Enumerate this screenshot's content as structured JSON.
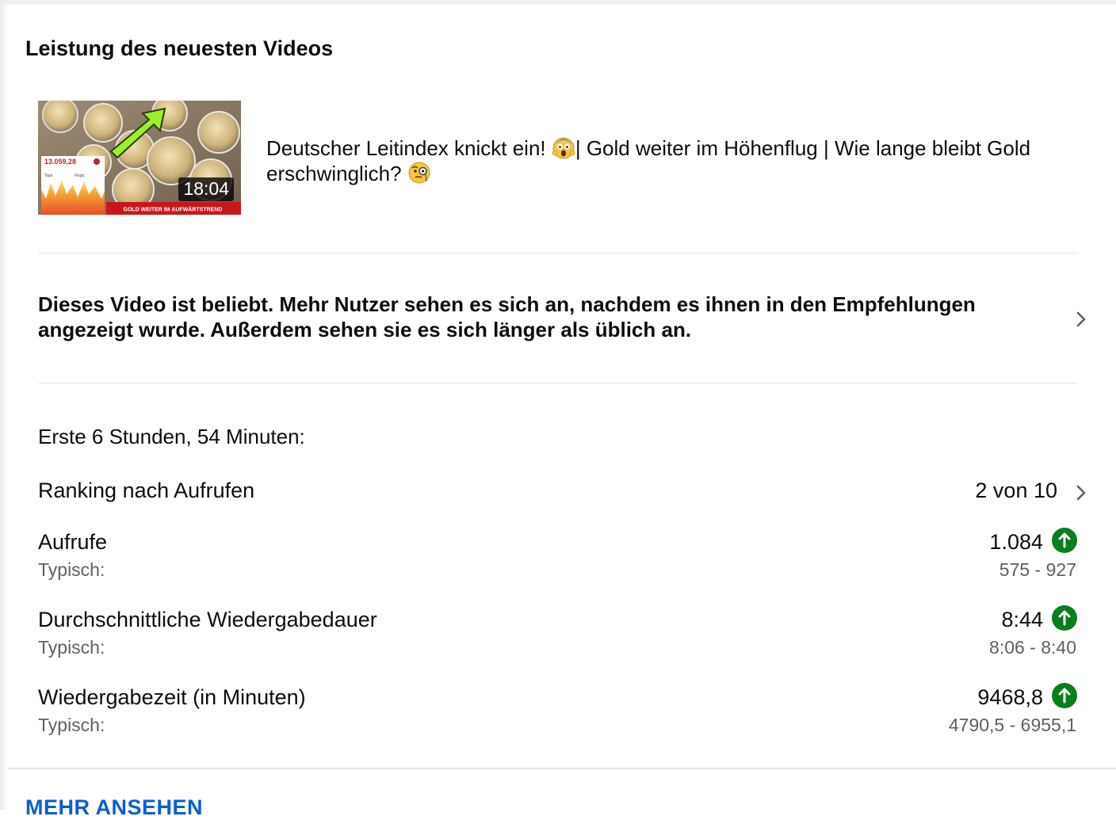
{
  "card": {
    "title": "Leistung des neuesten Videos"
  },
  "video": {
    "title_part1": "Deutscher Leitindex knickt ein! ",
    "title_emoji1": "face-screaming-in-fear-emoji",
    "title_part2": "| Gold weiter im Höhenflug | Wie lange bleibt Gold erschwinglich? ",
    "title_emoji2": "face-with-monocle-emoji",
    "duration": "18:04",
    "thumbnail": {
      "index_value": "13.059,28",
      "banner": "GOLD WEITER IM AUFWÄRTSTREND",
      "label_left": "Tops",
      "label_right": "Flops"
    }
  },
  "insight": {
    "text": "Dieses Video ist beliebt. Mehr Nutzer sehen es sich an, nachdem es ihnen in den Empfehlungen angezeigt wurde. Außerdem sehen sie es sich länger als üblich an."
  },
  "period": "Erste 6 Stunden, 54 Minuten:",
  "ranking": {
    "label": "Ranking nach Aufrufen",
    "value": "2 von 10"
  },
  "metrics": [
    {
      "label": "Aufrufe",
      "typical_label": "Typisch:",
      "value": "1.084",
      "typical_range": "575 - 927",
      "trend": "up"
    },
    {
      "label": "Durchschnittliche Wiedergabedauer",
      "typical_label": "Typisch:",
      "value": "8:44",
      "typical_range": "8:06 - 8:40",
      "trend": "up"
    },
    {
      "label": "Wiedergabezeit (in Minuten)",
      "typical_label": "Typisch:",
      "value": "9468,8",
      "typical_range": "4790,5 - 6955,1",
      "trend": "up"
    }
  ],
  "more_link": "MEHR ANSEHEN",
  "colors": {
    "trend_up": "#0a7d1c",
    "link": "#065fd4",
    "secondary_text": "#606060"
  }
}
